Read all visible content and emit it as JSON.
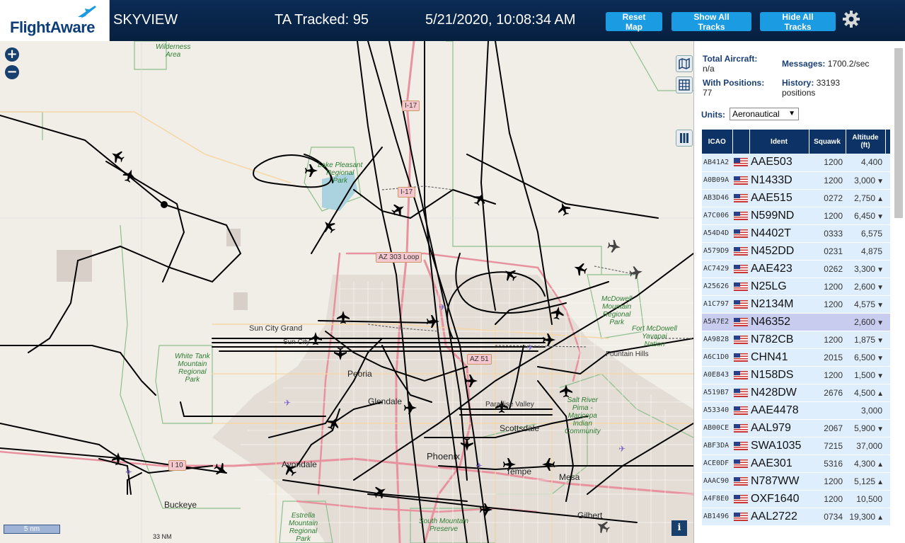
{
  "header": {
    "logo": "FlightAware",
    "app_name": "SKYVIEW",
    "ta_tracked": "TA Tracked: 95",
    "timestamp": "5/21/2020, 10:08:34 AM",
    "buttons": {
      "reset": "Reset Map",
      "show": "Show All Tracks",
      "hide": "Hide All Tracks"
    },
    "settings_icon": "gear-icon"
  },
  "map": {
    "zoom_in": "+",
    "zoom_out": "−",
    "scale": "5 nm",
    "scale_nm": "33 NM",
    "info": "i",
    "labels": {
      "wilderness": "Wilderness\nArea",
      "lake_pleasant": "Lake Pleasant\nRegional\nPark",
      "sun_city_grand": "Sun City Grand",
      "white_tank": "White Tank\nMountain\nRegional\nPark",
      "peoria": "Peoria",
      "glendale": "Glendale",
      "paradise_valley": "Paradise Valley",
      "scottsdale": "Scottsdale",
      "phoenix": "Phoenix",
      "tempe": "Tempe",
      "mesa": "Mesa",
      "buckeye": "Buckeye",
      "avondale": "Avondale",
      "gilbert": "Gilbert",
      "fountain_hills": "Fountain Hills",
      "fort_mcdowell": "Fort McDowell\nYavapai\nNation",
      "mcdowell": "McDowell\nMountain\nRegional\nPark",
      "salt_river": "Salt River\nPima -\nMaricopa\nIndian\nCommunity",
      "estrella": "Estrella\nMountain\nRegional\nPark",
      "south_mountain": "South Mountain\nPreserve",
      "sun_city": "Sun City"
    },
    "shields": {
      "i17_north": "I-17",
      "i17": "I-17",
      "az303": "AZ 303 Loop",
      "az51": "AZ 51",
      "i10": "I 10"
    }
  },
  "panel": {
    "total_aircraft_label": "Total Aircraft:",
    "total_aircraft_value": "n/a",
    "with_positions_label": "With Positions:",
    "with_positions_value": "77",
    "messages_label": "Messages:",
    "messages_value": "1700.2/sec",
    "history_label": "History:",
    "history_value": "33193",
    "history_unit": "positions",
    "units_label": "Units:",
    "units_value": "Aeronautical",
    "columns": {
      "icao": "ICAO",
      "ident": "Ident",
      "squawk": "Squawk",
      "altitude": "Altitude\n(ft)"
    },
    "rows": [
      {
        "icao": "AB41A2",
        "ident": "AAE503",
        "squawk": "1200",
        "alt": "4,400",
        "trend": ""
      },
      {
        "icao": "A0B09A",
        "ident": "N1433D",
        "squawk": "1200",
        "alt": "3,000",
        "trend": "▼"
      },
      {
        "icao": "AB3D46",
        "ident": "AAE515",
        "squawk": "0272",
        "alt": "2,750",
        "trend": "▲"
      },
      {
        "icao": "A7C006",
        "ident": "N599ND",
        "squawk": "1200",
        "alt": "6,450",
        "trend": "▼"
      },
      {
        "icao": "A54D4D",
        "ident": "N4402T",
        "squawk": "0333",
        "alt": "6,575",
        "trend": ""
      },
      {
        "icao": "A579D9",
        "ident": "N452DD",
        "squawk": "0231",
        "alt": "4,875",
        "trend": ""
      },
      {
        "icao": "AC7429",
        "ident": "AAE423",
        "squawk": "0262",
        "alt": "3,300",
        "trend": "▼"
      },
      {
        "icao": "A25626",
        "ident": "N25LG",
        "squawk": "1200",
        "alt": "2,600",
        "trend": "▼"
      },
      {
        "icao": "A1C797",
        "ident": "N2134M",
        "squawk": "1200",
        "alt": "4,575",
        "trend": "▼"
      },
      {
        "icao": "A5A7E2",
        "ident": "N46352",
        "squawk": "",
        "alt": "2,600",
        "trend": "▼",
        "selected": true
      },
      {
        "icao": "AA9828",
        "ident": "N782CB",
        "squawk": "1200",
        "alt": "1,875",
        "trend": "▼"
      },
      {
        "icao": "A6C1D0",
        "ident": "CHN41",
        "squawk": "2015",
        "alt": "6,500",
        "trend": "▼"
      },
      {
        "icao": "A0E843",
        "ident": "N158DS",
        "squawk": "1200",
        "alt": "1,500",
        "trend": "▼"
      },
      {
        "icao": "A519B7",
        "ident": "N428DW",
        "squawk": "2676",
        "alt": "4,500",
        "trend": "▲"
      },
      {
        "icao": "A53340",
        "ident": "AAE4478",
        "squawk": "",
        "alt": "3,000",
        "trend": ""
      },
      {
        "icao": "AB00CE",
        "ident": "AAL979",
        "squawk": "2067",
        "alt": "5,900",
        "trend": "▼"
      },
      {
        "icao": "ABF3DA",
        "ident": "SWA1035",
        "squawk": "7215",
        "alt": "37,000",
        "trend": ""
      },
      {
        "icao": "ACE0DF",
        "ident": "AAE301",
        "squawk": "5316",
        "alt": "4,300",
        "trend": "▲"
      },
      {
        "icao": "AAAC90",
        "ident": "N787WW",
        "squawk": "1200",
        "alt": "5,125",
        "trend": "▲"
      },
      {
        "icao": "A4F8E0",
        "ident": "OXF1640",
        "squawk": "1200",
        "alt": "10,500",
        "trend": ""
      },
      {
        "icao": "AB1496",
        "ident": "AAL2722",
        "squawk": "0734",
        "alt": "19,300",
        "trend": "▲"
      }
    ]
  }
}
